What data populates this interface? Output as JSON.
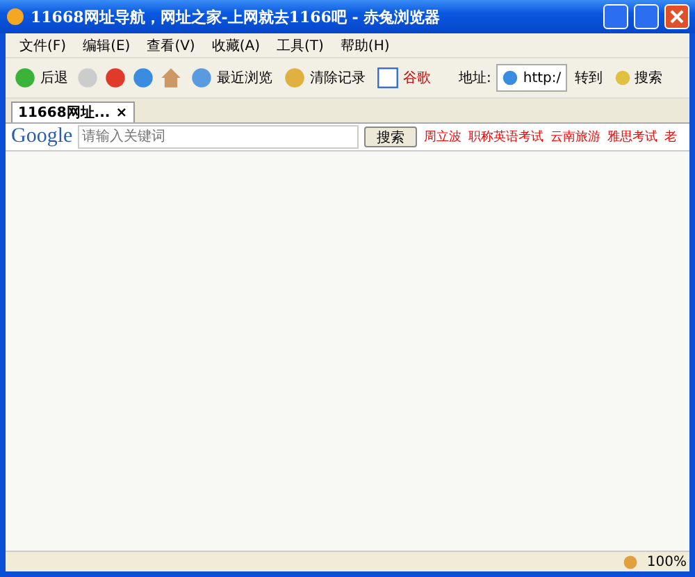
{
  "window": {
    "title": "11668网址导航，网址之家-上网就去1166吧  -  赤兔浏览器"
  },
  "menu": [
    "文件(F)",
    "编辑(E)",
    "查看(V)",
    "收藏(A)",
    "工具(T)",
    "帮助(H)"
  ],
  "toolbar": {
    "back": "后退",
    "recent": "最近浏览",
    "clear": "清除记录",
    "google": "谷歌",
    "address_label": "地址:",
    "address": "http:/",
    "go": "转到",
    "search": "搜索"
  },
  "tabs": [
    {
      "label": "11668网址...",
      "selected": true,
      "close": "×"
    }
  ],
  "google_bar": {
    "logo": "Google",
    "placeholder": "请输入关键词",
    "button": "搜索",
    "links": [
      "周立波",
      "职称英语考试",
      "云南旅游",
      "雅思考试",
      "老"
    ]
  },
  "status_bar": {
    "zoom": "100%"
  }
}
